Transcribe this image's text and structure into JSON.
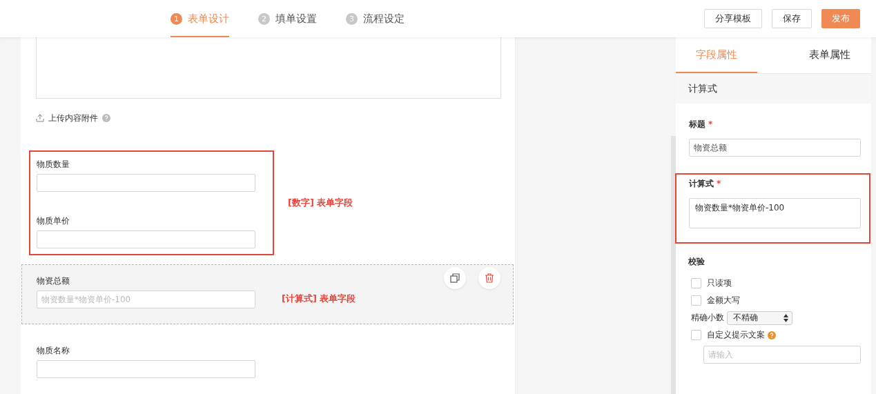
{
  "header": {
    "steps": [
      {
        "number": "1",
        "label": "表单设计",
        "selected": true
      },
      {
        "number": "2",
        "label": "填单设置",
        "selected": false
      },
      {
        "number": "3",
        "label": "流程设定",
        "selected": false
      }
    ],
    "buttons": [
      {
        "label": "分享模板",
        "kind": "default"
      },
      {
        "label": "保存",
        "kind": "default"
      },
      {
        "label": "发布",
        "kind": "primary"
      }
    ]
  },
  "canvas": {
    "upload": {
      "label": "上传内容附件"
    },
    "blocks": [
      {
        "kind": "group",
        "annotation": "[数字] 表单字段",
        "fields": [
          {
            "label": "物质数量"
          },
          {
            "label": "物质单价"
          }
        ]
      },
      {
        "kind": "field",
        "selected": true,
        "label": "物资总额",
        "placeholder": "物资数量*物资单价-100",
        "annotation": "[计算式] 表单字段"
      },
      {
        "kind": "field",
        "selected": false,
        "label": "物质名称"
      }
    ]
  },
  "properties": {
    "tabs": [
      {
        "label": "字段属性",
        "selected": true
      },
      {
        "label": "表单属性",
        "selected": false
      }
    ],
    "section_title": "计算式",
    "fields": [
      {
        "kind": "input",
        "label": "标题",
        "required_mark": "*",
        "value": "物资总额",
        "highlighted": false
      },
      {
        "kind": "textarea",
        "label": "计算式",
        "required_mark": "*",
        "value": "物资数量*物资单价-100",
        "highlighted": true
      }
    ],
    "validation": {
      "heading": "校验",
      "options": [
        {
          "kind": "checkbox",
          "label": "只读项",
          "checked": false
        },
        {
          "kind": "checkbox",
          "label": "金额大写",
          "checked": false
        },
        {
          "kind": "select",
          "label": "精确小数",
          "value": "不精确"
        },
        {
          "kind": "checkbox",
          "label": "自定义提示文案",
          "checked": false,
          "help": true
        }
      ],
      "hint_field": {
        "placeholder": "请输入"
      }
    }
  }
}
